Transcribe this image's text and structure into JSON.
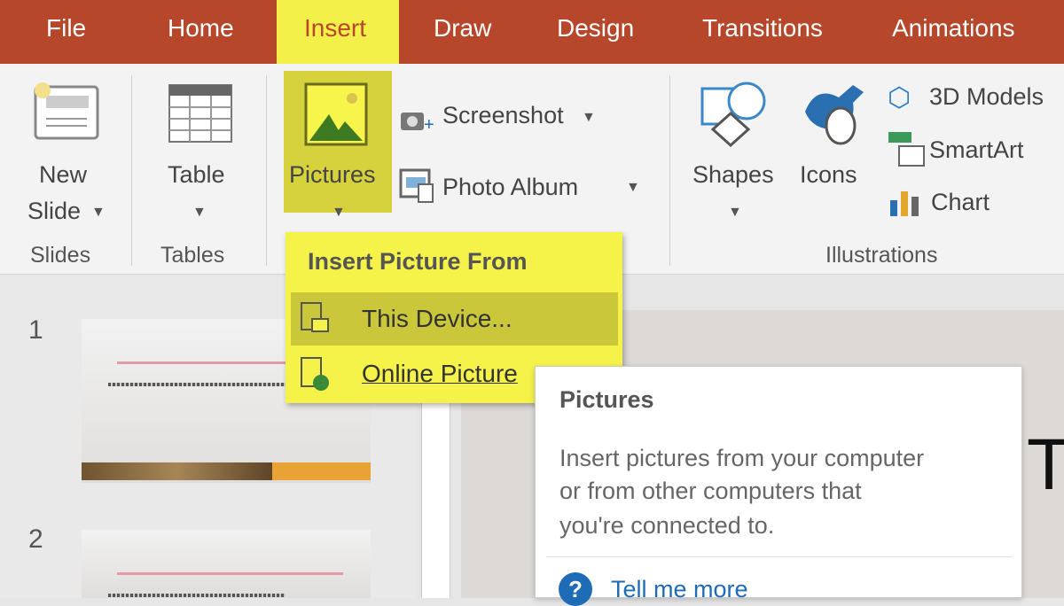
{
  "tabs": [
    "File",
    "Home",
    "Insert",
    "Draw",
    "Design",
    "Transitions",
    "Animations"
  ],
  "active_tab": "Insert",
  "ribbon": {
    "new_slide": [
      "New",
      "Slide"
    ],
    "table": "Table",
    "pictures": "Pictures",
    "screenshot": "Screenshot",
    "photo_album": "Photo Album",
    "shapes": "Shapes",
    "icons": "Icons",
    "models_3d": "3D Models",
    "smartart": "SmartArt",
    "chart": "Chart",
    "groups": {
      "slides": "Slides",
      "tables": "Tables",
      "illustrations": "Illustrations"
    }
  },
  "menu": {
    "header": "Insert Picture From",
    "items": [
      "This Device...",
      "Online Pictures..."
    ],
    "online_visible": "Online Picture"
  },
  "thumbnails": [
    "1",
    "2"
  ],
  "slide_letter": "T",
  "tooltip": {
    "title": "Pictures",
    "lines": [
      "Insert pictures from your computer",
      "or from other computers that",
      "you're connected to."
    ],
    "link": "Tell me more"
  },
  "colors": {
    "tabbar": "#b7472a",
    "highlight": "#f4f04a",
    "link": "#1e6cb5"
  }
}
